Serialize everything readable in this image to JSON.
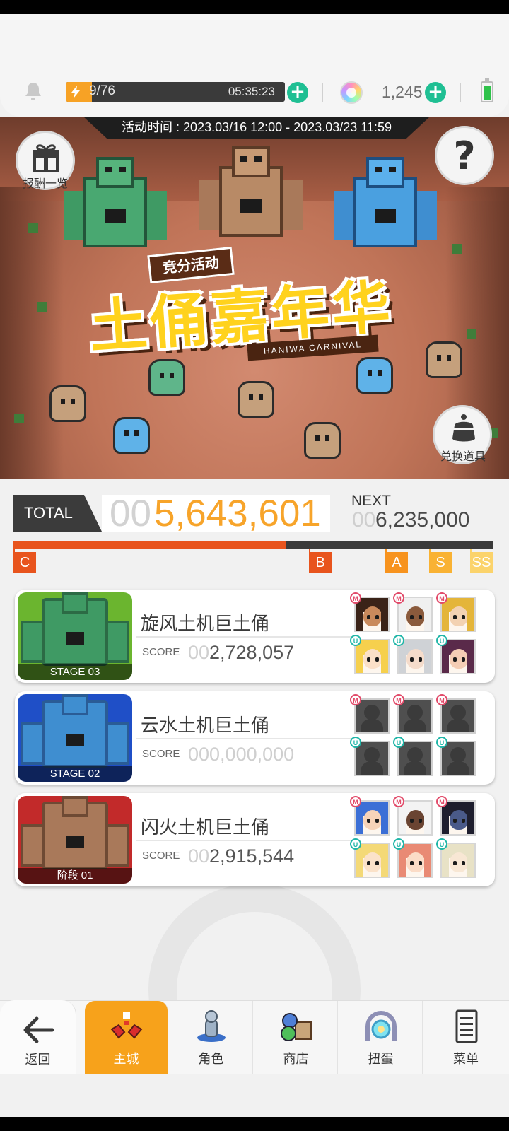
{
  "resources": {
    "energy_count": "9/76",
    "energy_level": 0.118,
    "energy_timer": "05:35:23",
    "gem_count": "1,245",
    "icons": [
      "bell-icon",
      "energy-bolt-icon",
      "rainbow-gem-icon",
      "battery-icon",
      "plus-icon"
    ]
  },
  "event": {
    "time_label": "活动时间 : 2023.03/16 12:00 - 2023.03/23 11:59",
    "rewards_label": "报酬一览",
    "help_symbol": "?",
    "exchange_label": "兑换道具",
    "logo_tag": "竞分活动",
    "logo_title": "土俑嘉年华",
    "logo_subtitle": "HANIWA CARNIVAL"
  },
  "score": {
    "total_label": "TOTAL",
    "total_prefix": "00",
    "total_value": "5,643,601",
    "next_label": "NEXT",
    "next_prefix": "00",
    "next_value": "6,235,000",
    "progress_fraction": 0.57,
    "ranks": [
      {
        "label": "C",
        "color": "#e8541d"
      },
      {
        "label": "B",
        "color": "#e8541d"
      },
      {
        "label": "A",
        "color": "#f7931e"
      },
      {
        "label": "S",
        "color": "#f9b233"
      },
      {
        "label": "SS",
        "color": "#fbd36b"
      }
    ]
  },
  "stages": [
    {
      "title": "旋风土机巨土俑",
      "stage_label": "STAGE 03",
      "score_label": "SCORE",
      "score_prefix": "00",
      "score_value": "2,728,057",
      "theme": {
        "bg": "#6bb52f",
        "golem": "#3f9a64",
        "dark": "#2c6b45"
      },
      "party": [
        {
          "badge": "M",
          "hair": "#3a2318",
          "skin": "#c98a5c"
        },
        {
          "badge": "M",
          "hair": "#f0f0f0",
          "skin": "#8a5a3c"
        },
        {
          "badge": "M",
          "hair": "#e4b53a",
          "skin": "#f3d2b2"
        },
        {
          "badge": "U",
          "hair": "#f6d04d",
          "skin": "#fbe0c8"
        },
        {
          "badge": "U",
          "hair": "#cfd2d6",
          "skin": "#f5dccb"
        },
        {
          "badge": "U",
          "hair": "#5a2a4a",
          "skin": "#f4cdb5"
        }
      ]
    },
    {
      "title": "云水土机巨土俑",
      "stage_label": "STAGE 02",
      "score_label": "SCORE",
      "score_prefix": "000,000,000",
      "score_value": "",
      "theme": {
        "bg": "#1f4fc7",
        "golem": "#3f8ed0",
        "dark": "#2a5c96"
      },
      "party": [
        {
          "badge": "M",
          "empty": true
        },
        {
          "badge": "M",
          "empty": true
        },
        {
          "badge": "M",
          "empty": true
        },
        {
          "badge": "U",
          "empty": true
        },
        {
          "badge": "U",
          "empty": true
        },
        {
          "badge": "U",
          "empty": true
        }
      ]
    },
    {
      "title": "闪火土机巨土俑",
      "stage_label": "阶段 01",
      "score_label": "SCORE",
      "score_prefix": "00",
      "score_value": "2,915,544",
      "theme": {
        "bg": "#c22a2a",
        "golem": "#a9795a",
        "dark": "#6e4a34"
      },
      "party": [
        {
          "badge": "M",
          "hair": "#3b6fd6",
          "skin": "#f6d3b9"
        },
        {
          "badge": "M",
          "hair": "#f3f3f3",
          "skin": "#6a4432"
        },
        {
          "badge": "M",
          "hair": "#1e1e2e",
          "skin": "#4a5a8a"
        },
        {
          "badge": "U",
          "hair": "#f4d977",
          "skin": "#fbe2c9"
        },
        {
          "badge": "U",
          "hair": "#e98a74",
          "skin": "#fbdcc7"
        },
        {
          "badge": "U",
          "hair": "#e8e2c6",
          "skin": "#f8e7d4"
        }
      ]
    }
  ],
  "nav": {
    "back_label": "返回",
    "items": [
      {
        "label": "主城",
        "icon": "main-city-icon",
        "active": true
      },
      {
        "label": "角色",
        "icon": "character-icon",
        "active": false
      },
      {
        "label": "商店",
        "icon": "shop-icon",
        "active": false
      },
      {
        "label": "扭蛋",
        "icon": "gacha-icon",
        "active": false
      },
      {
        "label": "菜单",
        "icon": "menu-icon",
        "active": false
      }
    ]
  },
  "colors": {
    "accent": "#f7a21b",
    "score_orange": "#f7a42a",
    "progress": "#e8541d",
    "plus": "#1fbf93"
  }
}
